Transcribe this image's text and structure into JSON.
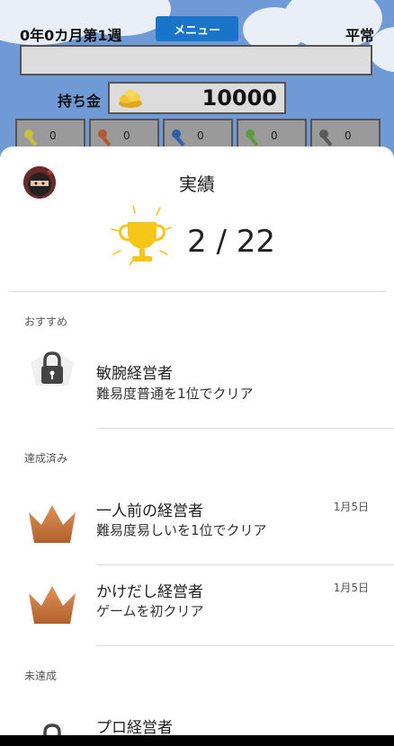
{
  "game": {
    "date": "0年0カ月第1週",
    "menu_label": "メニュー",
    "status": "平常",
    "message": "",
    "money_label": "持ち金",
    "money_value": "10000",
    "keys": [
      {
        "color": "#c8c03a",
        "count": "0"
      },
      {
        "color": "#b05a32",
        "count": "0"
      },
      {
        "color": "#2f5fa8",
        "count": "0"
      },
      {
        "color": "#5e9b3a",
        "count": "0"
      },
      {
        "color": "#5a5a5a",
        "count": "0"
      }
    ]
  },
  "sheet": {
    "title": "実績",
    "progress": "2 / 22",
    "sections": [
      {
        "label": "おすすめ",
        "items": [
          {
            "title": "敏腕経営者",
            "desc": "難易度普通を1位でクリア",
            "date": "",
            "icon": "lock-icon"
          }
        ]
      },
      {
        "label": "達成済み",
        "items": [
          {
            "title": "一人前の経営者",
            "desc": "難易度易しいを1位でクリア",
            "date": "1月5日",
            "icon": "bronze-crown-icon"
          },
          {
            "title": "かけだし経営者",
            "desc": "ゲームを初クリア",
            "date": "1月5日",
            "icon": "bronze-crown-icon"
          }
        ]
      },
      {
        "label": "未達成",
        "items": [
          {
            "title": "プロ経営者",
            "desc": "",
            "date": "",
            "icon": "lock-icon"
          }
        ]
      }
    ]
  },
  "colors": {
    "sky": "#6f9ad6",
    "menu_button": "#1a74c9",
    "trophy": "#f5c518",
    "bronze": "#c8783e"
  }
}
